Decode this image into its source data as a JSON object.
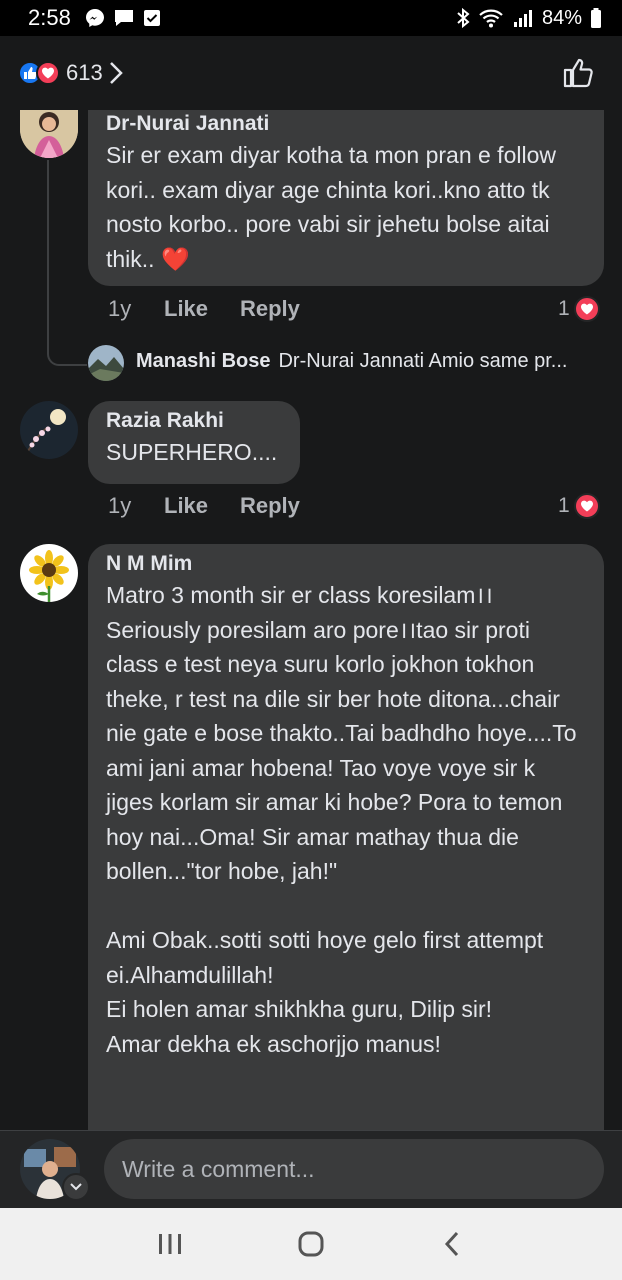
{
  "status_bar": {
    "time": "2:58",
    "battery": "84%"
  },
  "header": {
    "reaction_count": "613",
    "colors": {
      "like": "#1877f2",
      "love": "#f33e58"
    }
  },
  "comments": [
    {
      "author": "Dr-Nurai Jannati",
      "text": "Sir er exam diyar kotha ta mon pran e follow kori.. exam diyar age chinta kori..kno atto tk nosto korbo.. pore vabi sir jehetu bolse aitai thik.. ❤️",
      "time": "1y",
      "like_label": "Like",
      "reply_label": "Reply",
      "reaction_count": "1",
      "reply_preview": {
        "author": "Manashi Bose",
        "text": "Dr-Nurai Jannati Amio same pr..."
      }
    },
    {
      "author": "Razia Rakhi",
      "text": "SUPERHERO....",
      "time": "1y",
      "like_label": "Like",
      "reply_label": "Reply",
      "reaction_count": "1"
    },
    {
      "author": "N M Mim",
      "text": "Matro 3 month sir er class koresilam।।\nSeriously poresilam aro pore।।tao sir proti class e test neya suru korlo jokhon tokhon theke, r test  na dile sir ber hote ditona...chair nie gate e bose thakto..Tai badhdho hoye....To ami jani amar hobena! Tao voye voye sir k jiges korlam sir amar ki hobe? Pora to temon hoy nai...Oma! Sir amar mathay thua die bollen...\"tor hobe, jah!\"\n\nAmi Obak..sotti sotti hoye gelo first attempt ei.Alhamdulillah!\nEi holen amar shikhkha guru, Dilip sir!\nAmar dekha ek aschorjjo manus!"
    }
  ],
  "composer": {
    "placeholder": "Write a comment..."
  }
}
